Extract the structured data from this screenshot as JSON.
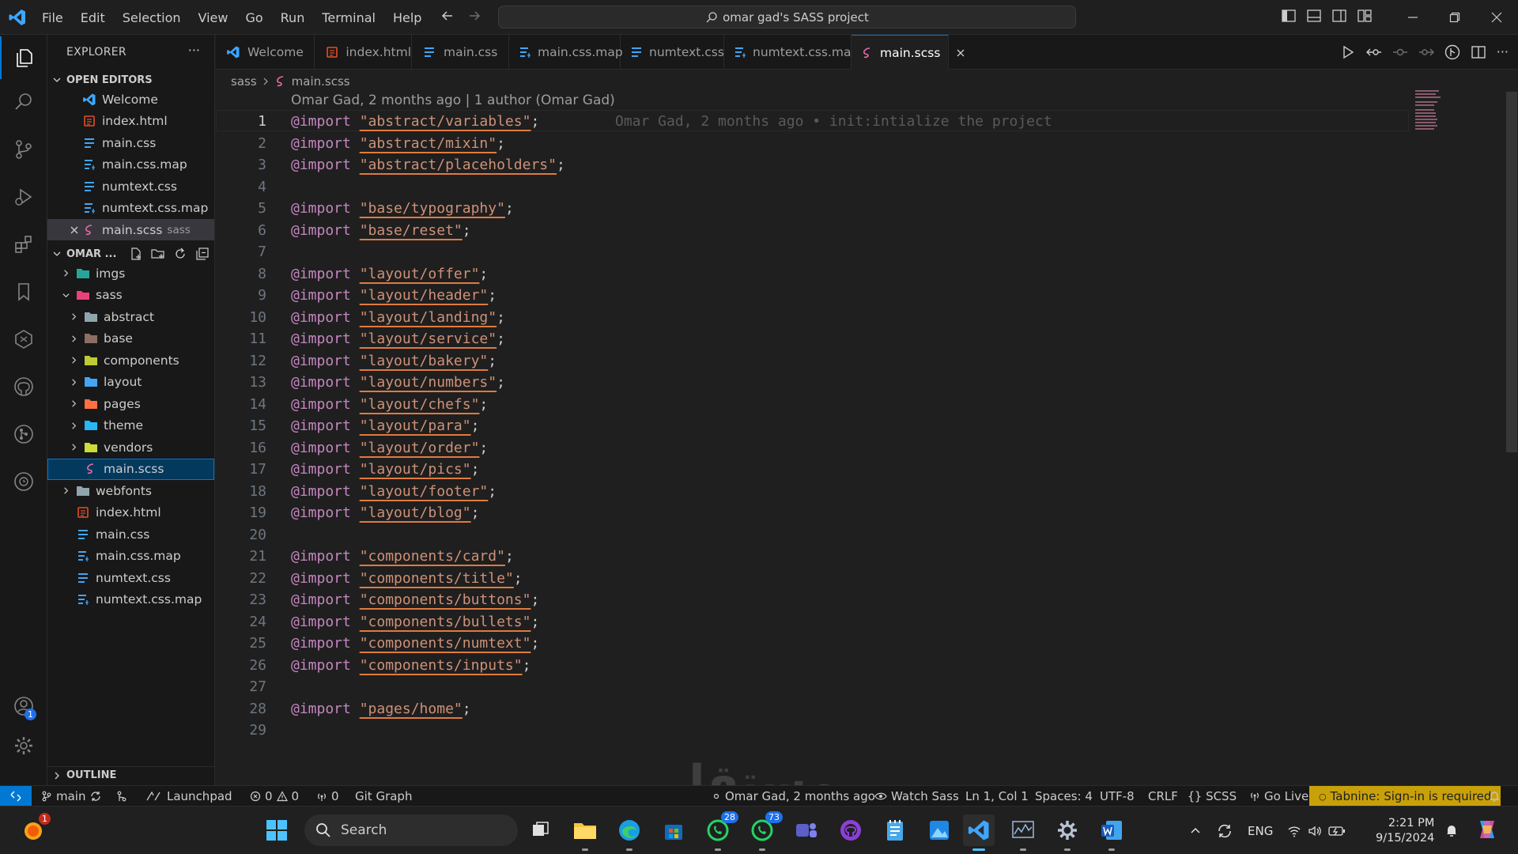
{
  "titlebar": {
    "menu": [
      "File",
      "Edit",
      "Selection",
      "View",
      "Go",
      "Run",
      "Terminal",
      "Help"
    ],
    "command_center": "omar gad's SASS project"
  },
  "sidebar": {
    "title": "EXPLORER",
    "open_editors_label": "OPEN EDITORS",
    "open_editors": [
      {
        "label": "Welcome",
        "icon": "vscode-icon"
      },
      {
        "label": "index.html",
        "icon": "html-file-icon"
      },
      {
        "label": "main.css",
        "icon": "css-file-icon"
      },
      {
        "label": "main.css.map",
        "icon": "map-file-icon"
      },
      {
        "label": "numtext.css",
        "icon": "css-file-icon"
      },
      {
        "label": "numtext.css.map",
        "icon": "map-file-icon"
      },
      {
        "label": "main.scss",
        "icon": "sass-file-icon",
        "desc": "sass"
      }
    ],
    "project_label": "OMAR ...",
    "tree": [
      {
        "label": "imgs",
        "type": "folder"
      },
      {
        "label": "sass",
        "type": "folder-open"
      },
      {
        "label": "abstract",
        "type": "folder"
      },
      {
        "label": "base",
        "type": "folder"
      },
      {
        "label": "components",
        "type": "folder"
      },
      {
        "label": "layout",
        "type": "folder"
      },
      {
        "label": "pages",
        "type": "folder"
      },
      {
        "label": "theme",
        "type": "folder"
      },
      {
        "label": "vendors",
        "type": "folder"
      },
      {
        "label": "main.scss",
        "type": "sass"
      },
      {
        "label": "webfonts",
        "type": "folder"
      },
      {
        "label": "index.html",
        "type": "html"
      },
      {
        "label": "main.css",
        "type": "css"
      },
      {
        "label": "main.css.map",
        "type": "map"
      },
      {
        "label": "numtext.css",
        "type": "css"
      },
      {
        "label": "numtext.css.map",
        "type": "map"
      }
    ],
    "outline_label": "OUTLINE"
  },
  "tabs": [
    {
      "label": "Welcome"
    },
    {
      "label": "index.html"
    },
    {
      "label": "main.css"
    },
    {
      "label": "main.css.map"
    },
    {
      "label": "numtext.css"
    },
    {
      "label": "numtext.css.map"
    },
    {
      "label": "main.scss",
      "active": true
    }
  ],
  "breadcrumb": {
    "folder": "sass",
    "file": "main.scss"
  },
  "blame_header": "Omar Gad, 2 months ago | 1 author (Omar Gad)",
  "inline_blame": "Omar Gad, 2 months ago • init:intialize the project",
  "code_lines": [
    {
      "n": "1",
      "path": "\"abstract/variables\""
    },
    {
      "n": "2",
      "path": "\"abstract/mixin\""
    },
    {
      "n": "3",
      "path": "\"abstract/placeholders\""
    },
    {
      "n": "4",
      "path": ""
    },
    {
      "n": "5",
      "path": "\"base/typography\""
    },
    {
      "n": "6",
      "path": "\"base/reset\""
    },
    {
      "n": "7",
      "path": ""
    },
    {
      "n": "8",
      "path": "\"layout/offer\""
    },
    {
      "n": "9",
      "path": "\"layout/header\""
    },
    {
      "n": "10",
      "path": "\"layout/landing\""
    },
    {
      "n": "11",
      "path": "\"layout/service\""
    },
    {
      "n": "12",
      "path": "\"layout/bakery\""
    },
    {
      "n": "13",
      "path": "\"layout/numbers\""
    },
    {
      "n": "14",
      "path": "\"layout/chefs\""
    },
    {
      "n": "15",
      "path": "\"layout/para\""
    },
    {
      "n": "16",
      "path": "\"layout/order\""
    },
    {
      "n": "17",
      "path": "\"layout/pics\""
    },
    {
      "n": "18",
      "path": "\"layout/footer\""
    },
    {
      "n": "19",
      "path": "\"layout/blog\""
    },
    {
      "n": "20",
      "path": ""
    },
    {
      "n": "21",
      "path": "\"components/card\""
    },
    {
      "n": "22",
      "path": "\"components/title\""
    },
    {
      "n": "23",
      "path": "\"components/buttons\""
    },
    {
      "n": "24",
      "path": "\"components/bullets\""
    },
    {
      "n": "25",
      "path": "\"components/numtext\""
    },
    {
      "n": "26",
      "path": "\"components/inputs\""
    },
    {
      "n": "27",
      "path": ""
    },
    {
      "n": "28",
      "path": "\"pages/home\""
    },
    {
      "n": "29",
      "path": ""
    }
  ],
  "keyword": "@import",
  "statusbar": {
    "branch": "main",
    "launchpad": "Launchpad",
    "errors": "0",
    "warnings": "0",
    "ports": "0",
    "git_graph": "Git Graph",
    "blame": "Omar Gad, 2 months ago",
    "watch_sass": "Watch Sass",
    "position": "Ln 1, Col 1",
    "spaces": "Spaces: 4",
    "encoding": "UTF-8",
    "eol": "CRLF",
    "language": "SCSS",
    "go_live": "Go Live",
    "tabnine": "Tabnine: Sign-in is required"
  },
  "taskbar": {
    "search_placeholder": "Search",
    "whatsapp_badge": "28",
    "whatsapp2_badge": "73",
    "notif_badge": "1",
    "language": "ENG",
    "time": "2:21 PM",
    "date": "9/15/2024"
  },
  "accounts_badge": "1",
  "watermark": "مستقل",
  "colors": {
    "accent": "#0078d4",
    "keyword": "#c586c0",
    "string": "#ce9178",
    "tabnine": "#c8a10a"
  }
}
